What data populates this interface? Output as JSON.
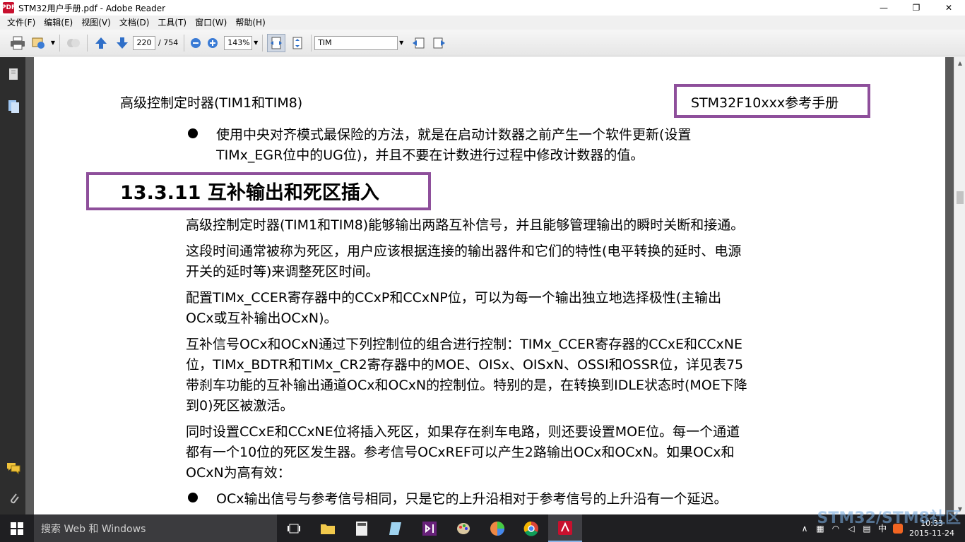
{
  "window": {
    "title": "STM32用户手册.pdf - Adobe Reader",
    "app_icon_label": "PDF",
    "minimize": "—",
    "restore": "❐",
    "close": "✕"
  },
  "menu": [
    "文件(F)",
    "编辑(E)",
    "视图(V)",
    "文档(D)",
    "工具(T)",
    "窗口(W)",
    "帮助(H)"
  ],
  "toolbar": {
    "page_current": "220",
    "page_total": "/ 754",
    "zoom": "143%",
    "find_text": "TIM"
  },
  "document": {
    "running_header_left": "高级控制定时器(TIM1和TIM8)",
    "running_header_right": "STM32F10xxx参考手册",
    "bullet1_line1": "使用中央对齐模式最保险的方法，就是在启动计数器之前产生一个软件更新(设置",
    "bullet1_line2": "TIMx_EGR位中的UG位)，并且不要在计数进行过程中修改计数器的值。",
    "section_heading": "13.3.11  互补输出和死区插入",
    "para1": "高级控制定时器(TIM1和TIM8)能够输出两路互补信号，并且能够管理输出的瞬时关断和接通。",
    "para2_line1": "这段时间通常被称为死区，用户应该根据连接的输出器件和它们的特性(电平转换的延时、电源",
    "para2_line2": "开关的延时等)来调整死区时间。",
    "para3_line1": "配置TIMx_CCER寄存器中的CCxP和CCxNP位，可以为每一个输出独立地选择极性(主输出",
    "para3_line2": "OCx或互补输出OCxN)。",
    "para4_line1": "互补信号OCx和OCxN通过下列控制位的组合进行控制：TIMx_CCER寄存器的CCxE和CCxNE",
    "para4_line2": "位，TIMx_BDTR和TIMx_CR2寄存器中的MOE、OISx、OISxN、OSSI和OSSR位，详见表75",
    "para4_line3": "带刹车功能的互补输出通道OCx和OCxN的控制位。特别的是，在转换到IDLE状态时(MOE下降",
    "para4_line4": "到0)死区被激活。",
    "para5_line1": "同时设置CCxE和CCxNE位将插入死区，如果存在刹车电路，则还要设置MOE位。每一个通道",
    "para5_line2": "都有一个10位的死区发生器。参考信号OCxREF可以产生2路输出OCx和OCxN。如果OCx和",
    "para5_line3": "OCxN为高有效：",
    "bullet2": "OCx输出信号与参考信号相同，只是它的上升沿相对于参考信号的上升沿有一个延迟。"
  },
  "taskbar": {
    "search_placeholder": "搜索 Web 和 Windows",
    "time": "10:33",
    "date": "2015-11-24",
    "ime": "中"
  },
  "watermark": "STM32/STM8社区",
  "colors": {
    "highlight_box": "#8e4f9b",
    "nav_pane": "#2d2d2d",
    "taskbar": "#1f1f22"
  }
}
